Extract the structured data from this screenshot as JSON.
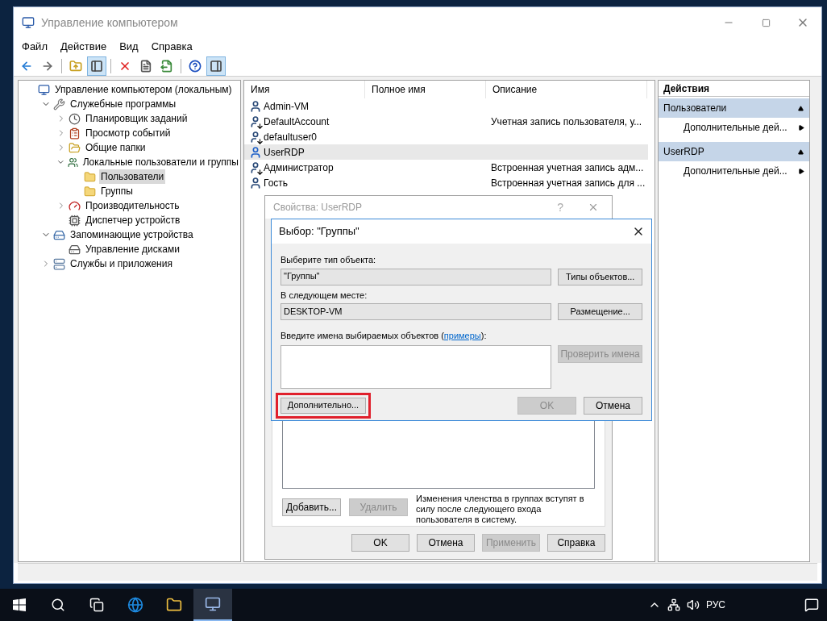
{
  "window": {
    "title": "Управление компьютером"
  },
  "menu": [
    "Файл",
    "Действие",
    "Вид",
    "Справка"
  ],
  "toolbar": [
    [
      {
        "kind": "back",
        "pressed": false
      },
      {
        "kind": "forward",
        "pressed": false
      }
    ],
    [
      {
        "kind": "up",
        "pressed": false
      },
      {
        "kind": "tree",
        "pressed": true
      }
    ],
    [
      {
        "kind": "delete",
        "pressed": false
      },
      {
        "kind": "properties",
        "pressed": false
      },
      {
        "kind": "export",
        "pressed": false
      }
    ],
    [
      {
        "kind": "help",
        "pressed": false
      },
      {
        "kind": "actionpane",
        "pressed": true
      }
    ]
  ],
  "tree": [
    {
      "label": "Управление компьютером (локальным)",
      "kind": "computer",
      "selected": false,
      "children": [
        {
          "label": "Служебные программы",
          "kind": "tools",
          "expanded": true,
          "selected": false,
          "children": [
            {
              "label": "Планировщик заданий",
              "kind": "clock",
              "expanded": false,
              "selected": false
            },
            {
              "label": "Просмотр событий",
              "kind": "events",
              "expanded": false,
              "selected": false
            },
            {
              "label": "Общие папки",
              "kind": "shared",
              "expanded": false,
              "selected": false
            },
            {
              "label": "Локальные пользователи и группы",
              "kind": "users",
              "expanded": true,
              "selected": false,
              "children": [
                {
                  "label": "Пользователи",
                  "kind": "folder",
                  "selected": true
                },
                {
                  "label": "Группы",
                  "kind": "folder",
                  "selected": false
                }
              ]
            },
            {
              "label": "Производительность",
              "kind": "perf",
              "expanded": false,
              "selected": false
            },
            {
              "label": "Диспетчер устройств",
              "kind": "devices",
              "selected": false
            }
          ]
        },
        {
          "label": "Запоминающие устройства",
          "kind": "storage",
          "expanded": true,
          "selected": false,
          "children": [
            {
              "label": "Управление дисками",
              "kind": "disk",
              "selected": false
            }
          ]
        },
        {
          "label": "Службы и приложения",
          "kind": "services",
          "expanded": false,
          "selected": false
        }
      ]
    }
  ],
  "list": {
    "columns": [
      "Имя",
      "Полное имя",
      "Описание"
    ],
    "rows": [
      {
        "name": "Admin-VM",
        "disabled": false,
        "selected": false
      },
      {
        "name": "DefaultAccount",
        "description": "Учетная запись пользователя, у...",
        "disabled": true,
        "selected": false
      },
      {
        "name": "defaultuser0",
        "disabled": true,
        "selected": false
      },
      {
        "name": "UserRDP",
        "disabled": false,
        "selected": true
      },
      {
        "name": "Администратор",
        "description": "Встроенная учетная запись адм...",
        "disabled": true,
        "selected": false
      },
      {
        "name": "Гость",
        "description": "Встроенная учетная запись для ...",
        "disabled": false,
        "selected": false
      }
    ]
  },
  "actions": {
    "title": "Действия",
    "sections": [
      {
        "title": "Пользователи",
        "expanded": true,
        "items": [
          "Дополнительные дей..."
        ]
      },
      {
        "title": "UserRDP",
        "expanded": true,
        "items": [
          "Дополнительные дей..."
        ]
      }
    ]
  },
  "properties_dialog": {
    "title": "Свойства: UserRDP",
    "help": "?",
    "buttons": [
      {
        "label": "Добавить...",
        "disabled": false
      },
      {
        "label": "Удалить",
        "disabled": true
      }
    ],
    "note": "Изменения членства в группах вступят в силу после следующего входа пользователя в систему.",
    "footer": [
      {
        "label": "OK",
        "disabled": false
      },
      {
        "label": "Отмена",
        "disabled": false
      },
      {
        "label": "Применить",
        "disabled": true
      },
      {
        "label": "Справка",
        "disabled": false
      }
    ]
  },
  "select_dialog": {
    "title": "Выбор: \"Группы\"",
    "object_type_label": "Выберите тип объекта:",
    "object_type": "\"Группы\"",
    "object_type_button": "Типы объектов...",
    "location_label": "В следующем месте:",
    "location": "DESKTOP-VM",
    "location_button": "Размещение...",
    "names_label_before": "Введите имена выбираемых объектов (",
    "names_link": "примеры",
    "names_label_after": "):",
    "check_button": {
      "label": "Проверить имена",
      "disabled": true
    },
    "advanced_button": {
      "label": "Дополнительно...",
      "highlighted": true
    },
    "ok_button": {
      "label": "OK",
      "disabled": true
    },
    "cancel_button": {
      "label": "Отмена",
      "disabled": false
    }
  },
  "taskbar": {
    "apps": [
      {
        "kind": "browser",
        "active": false
      },
      {
        "kind": "explorer",
        "active": false
      },
      {
        "kind": "console",
        "active": true
      }
    ],
    "language": "РУС"
  }
}
